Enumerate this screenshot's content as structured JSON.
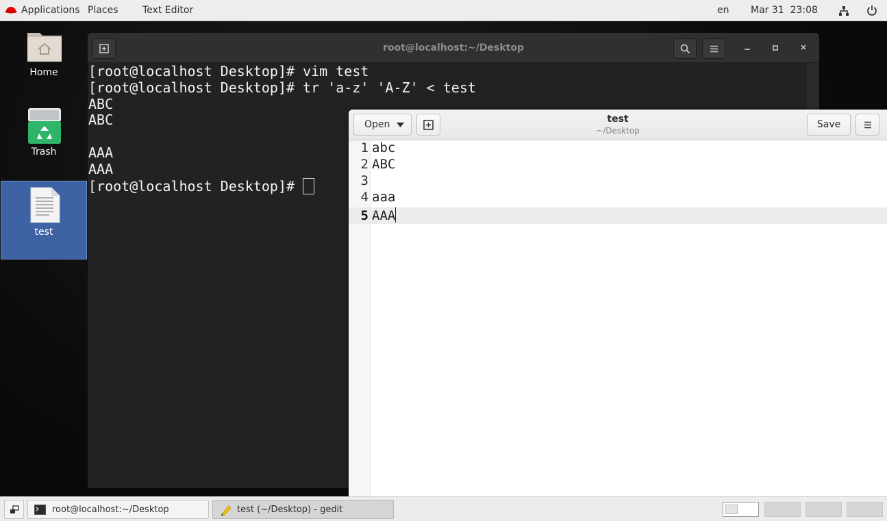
{
  "topbar": {
    "applications": "Applications",
    "places": "Places",
    "text_editor": "Text Editor",
    "lang": "en",
    "datetime": "Mar 31  23:08"
  },
  "desktop": {
    "icons": [
      {
        "label": "Home",
        "icon": "folder-home-icon"
      },
      {
        "label": "Trash",
        "icon": "trash-icon"
      },
      {
        "label": "test",
        "icon": "text-file-icon"
      }
    ]
  },
  "terminal": {
    "title": "root@localhost:~/Desktop",
    "lines": [
      "[root@localhost Desktop]# vim test",
      "[root@localhost Desktop]# tr 'a-z' 'A-Z' < test",
      "ABC",
      "ABC",
      "",
      "AAA",
      "AAA"
    ],
    "prompt": "[root@localhost Desktop]# "
  },
  "gedit": {
    "open_label": "Open",
    "save_label": "Save",
    "title": "test",
    "subtitle": "~/Desktop",
    "lines": [
      {
        "num": "1",
        "text": "abc"
      },
      {
        "num": "2",
        "text": "ABC"
      },
      {
        "num": "3",
        "text": ""
      },
      {
        "num": "4",
        "text": "aaa"
      },
      {
        "num": "5",
        "text": "AAA"
      }
    ],
    "current_line": 5
  },
  "taskbar": {
    "tasks": [
      {
        "label": "root@localhost:~/Desktop",
        "icon": "terminal-icon",
        "active": false
      },
      {
        "label": "test (~/Desktop) - gedit",
        "icon": "text-editor-icon",
        "active": true
      }
    ],
    "workspaces": 4,
    "active_workspace": 1
  },
  "colors": {
    "terminal_bg": "#222222",
    "selection": "#3d63a4",
    "topbar_bg": "#ededed"
  }
}
